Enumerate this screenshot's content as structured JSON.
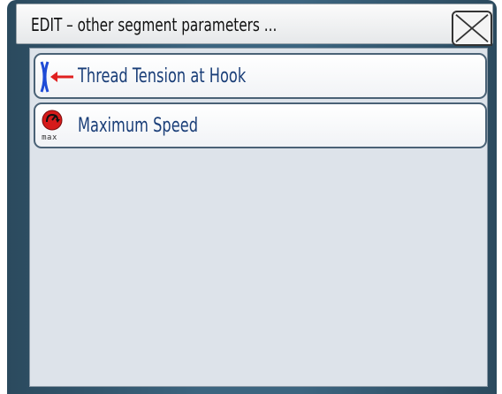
{
  "dialog": {
    "title": "EDIT – other segment parameters ...",
    "close_icon": "close-x-icon"
  },
  "items": [
    {
      "label": "Thread Tension at Hook",
      "icon": "thread-tension-icon"
    },
    {
      "label": "Maximum Speed",
      "icon": "max-speed-icon",
      "icon_text": "max"
    }
  ],
  "colors": {
    "frame": "#3c6580",
    "label_text": "#1a3e78",
    "tension_bracket": "#1f4bd6",
    "tension_arrow": "#e02020",
    "speed_icon": "#d61a1a",
    "content_bg": "#dde3ea"
  }
}
